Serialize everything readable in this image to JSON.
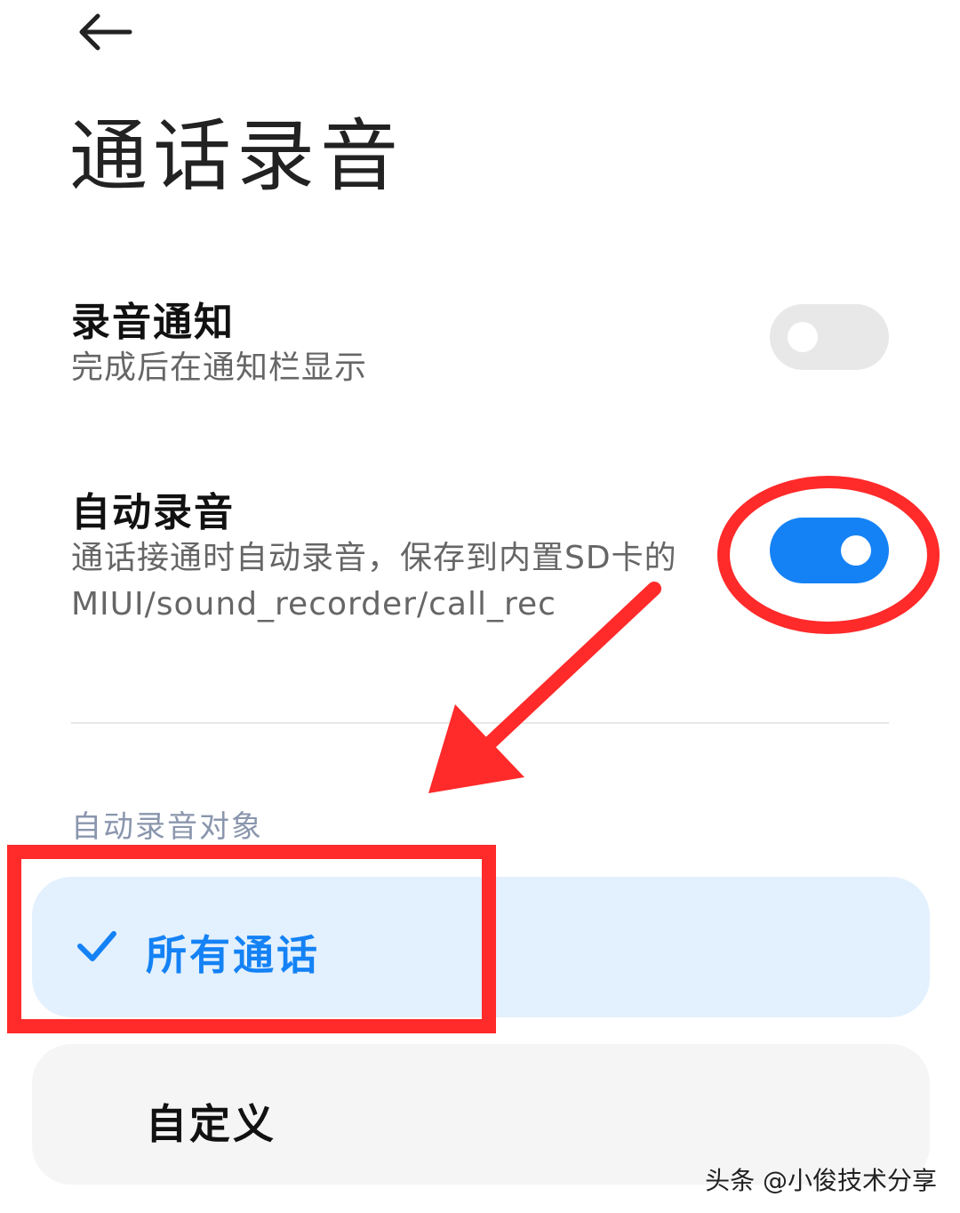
{
  "header": {
    "back_icon": "arrow-left-icon",
    "title": "通话录音"
  },
  "settings": [
    {
      "title": "录音通知",
      "subtitle": "完成后在通知栏显示",
      "toggle": "off"
    },
    {
      "title": "自动录音",
      "subtitle_line1": "通话接通时自动录音，保存到内置SD卡的",
      "subtitle_line2": "MIUI/sound_recorder/call_rec",
      "toggle": "on"
    }
  ],
  "section": {
    "label": "自动录音对象"
  },
  "options": [
    {
      "label": "所有通话",
      "selected": true,
      "icon": "checkmark-icon"
    },
    {
      "label": "自定义",
      "selected": false
    }
  ],
  "annotations": {
    "highlight_color": "#ff2a2a"
  },
  "colors": {
    "accent": "#1482f5",
    "selected_bg": "#e3f0fd",
    "section_label": "#8a96ad"
  },
  "watermark": "头条 @小俊技术分享"
}
